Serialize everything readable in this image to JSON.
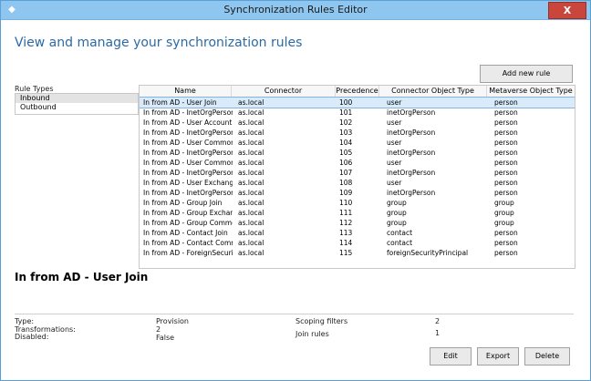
{
  "window": {
    "title": "Synchronization Rules Editor",
    "close_label": "X"
  },
  "heading": "View and manage your synchronization rules",
  "add_rule_label": "Add new rule",
  "rule_types": {
    "label": "Rule Types",
    "items": [
      "Inbound",
      "Outbound"
    ]
  },
  "grid": {
    "columns": [
      "Name",
      "Connector",
      "Precedence",
      "Connector Object Type",
      "Metaverse Object Type"
    ],
    "rows": [
      [
        "In from AD - User Join",
        "as.local",
        "100",
        "user",
        "person"
      ],
      [
        "In from AD - InetOrgPerson Jo",
        "as.local",
        "101",
        "inetOrgPerson",
        "person"
      ],
      [
        "In from AD - User AccountEna",
        "as.local",
        "102",
        "user",
        "person"
      ],
      [
        "In from AD - InetOrgPerson A",
        "as.local",
        "103",
        "inetOrgPerson",
        "person"
      ],
      [
        "In from AD - User Common fr",
        "as.local",
        "104",
        "user",
        "person"
      ],
      [
        "In from AD - InetOrgPerson C",
        "as.local",
        "105",
        "inetOrgPerson",
        "person"
      ],
      [
        "In from AD - User Common",
        "as.local",
        "106",
        "user",
        "person"
      ],
      [
        "In from AD - InetOrgPerson C",
        "as.local",
        "107",
        "inetOrgPerson",
        "person"
      ],
      [
        "In from AD - User Exchange",
        "as.local",
        "108",
        "user",
        "person"
      ],
      [
        "In from AD - InetOrgPerson E",
        "as.local",
        "109",
        "inetOrgPerson",
        "person"
      ],
      [
        "In from AD - Group Join",
        "as.local",
        "110",
        "group",
        "group"
      ],
      [
        "In from AD - Group Exchange",
        "as.local",
        "111",
        "group",
        "group"
      ],
      [
        "In from AD - Group Common",
        "as.local",
        "112",
        "group",
        "group"
      ],
      [
        "In from AD - Contact Join",
        "as.local",
        "113",
        "contact",
        "person"
      ],
      [
        "In from AD - Contact Commor",
        "as.local",
        "114",
        "contact",
        "person"
      ],
      [
        "In from AD - ForeignSecurityP",
        "as.local",
        "115",
        "foreignSecurityPrincipal",
        "person"
      ]
    ]
  },
  "detail": {
    "title": "In from AD - User Join",
    "type_label": "Type:",
    "type_value": "Provision",
    "transformations_label": "Transformations:",
    "transformations_value": "2",
    "disabled_label": "Disabled:",
    "disabled_value": "False",
    "scoping_label": "Scoping filters",
    "scoping_value": "2",
    "join_label": "Join rules",
    "join_value": "1"
  },
  "buttons": {
    "edit": "Edit",
    "export": "Export",
    "delete": "Delete"
  }
}
